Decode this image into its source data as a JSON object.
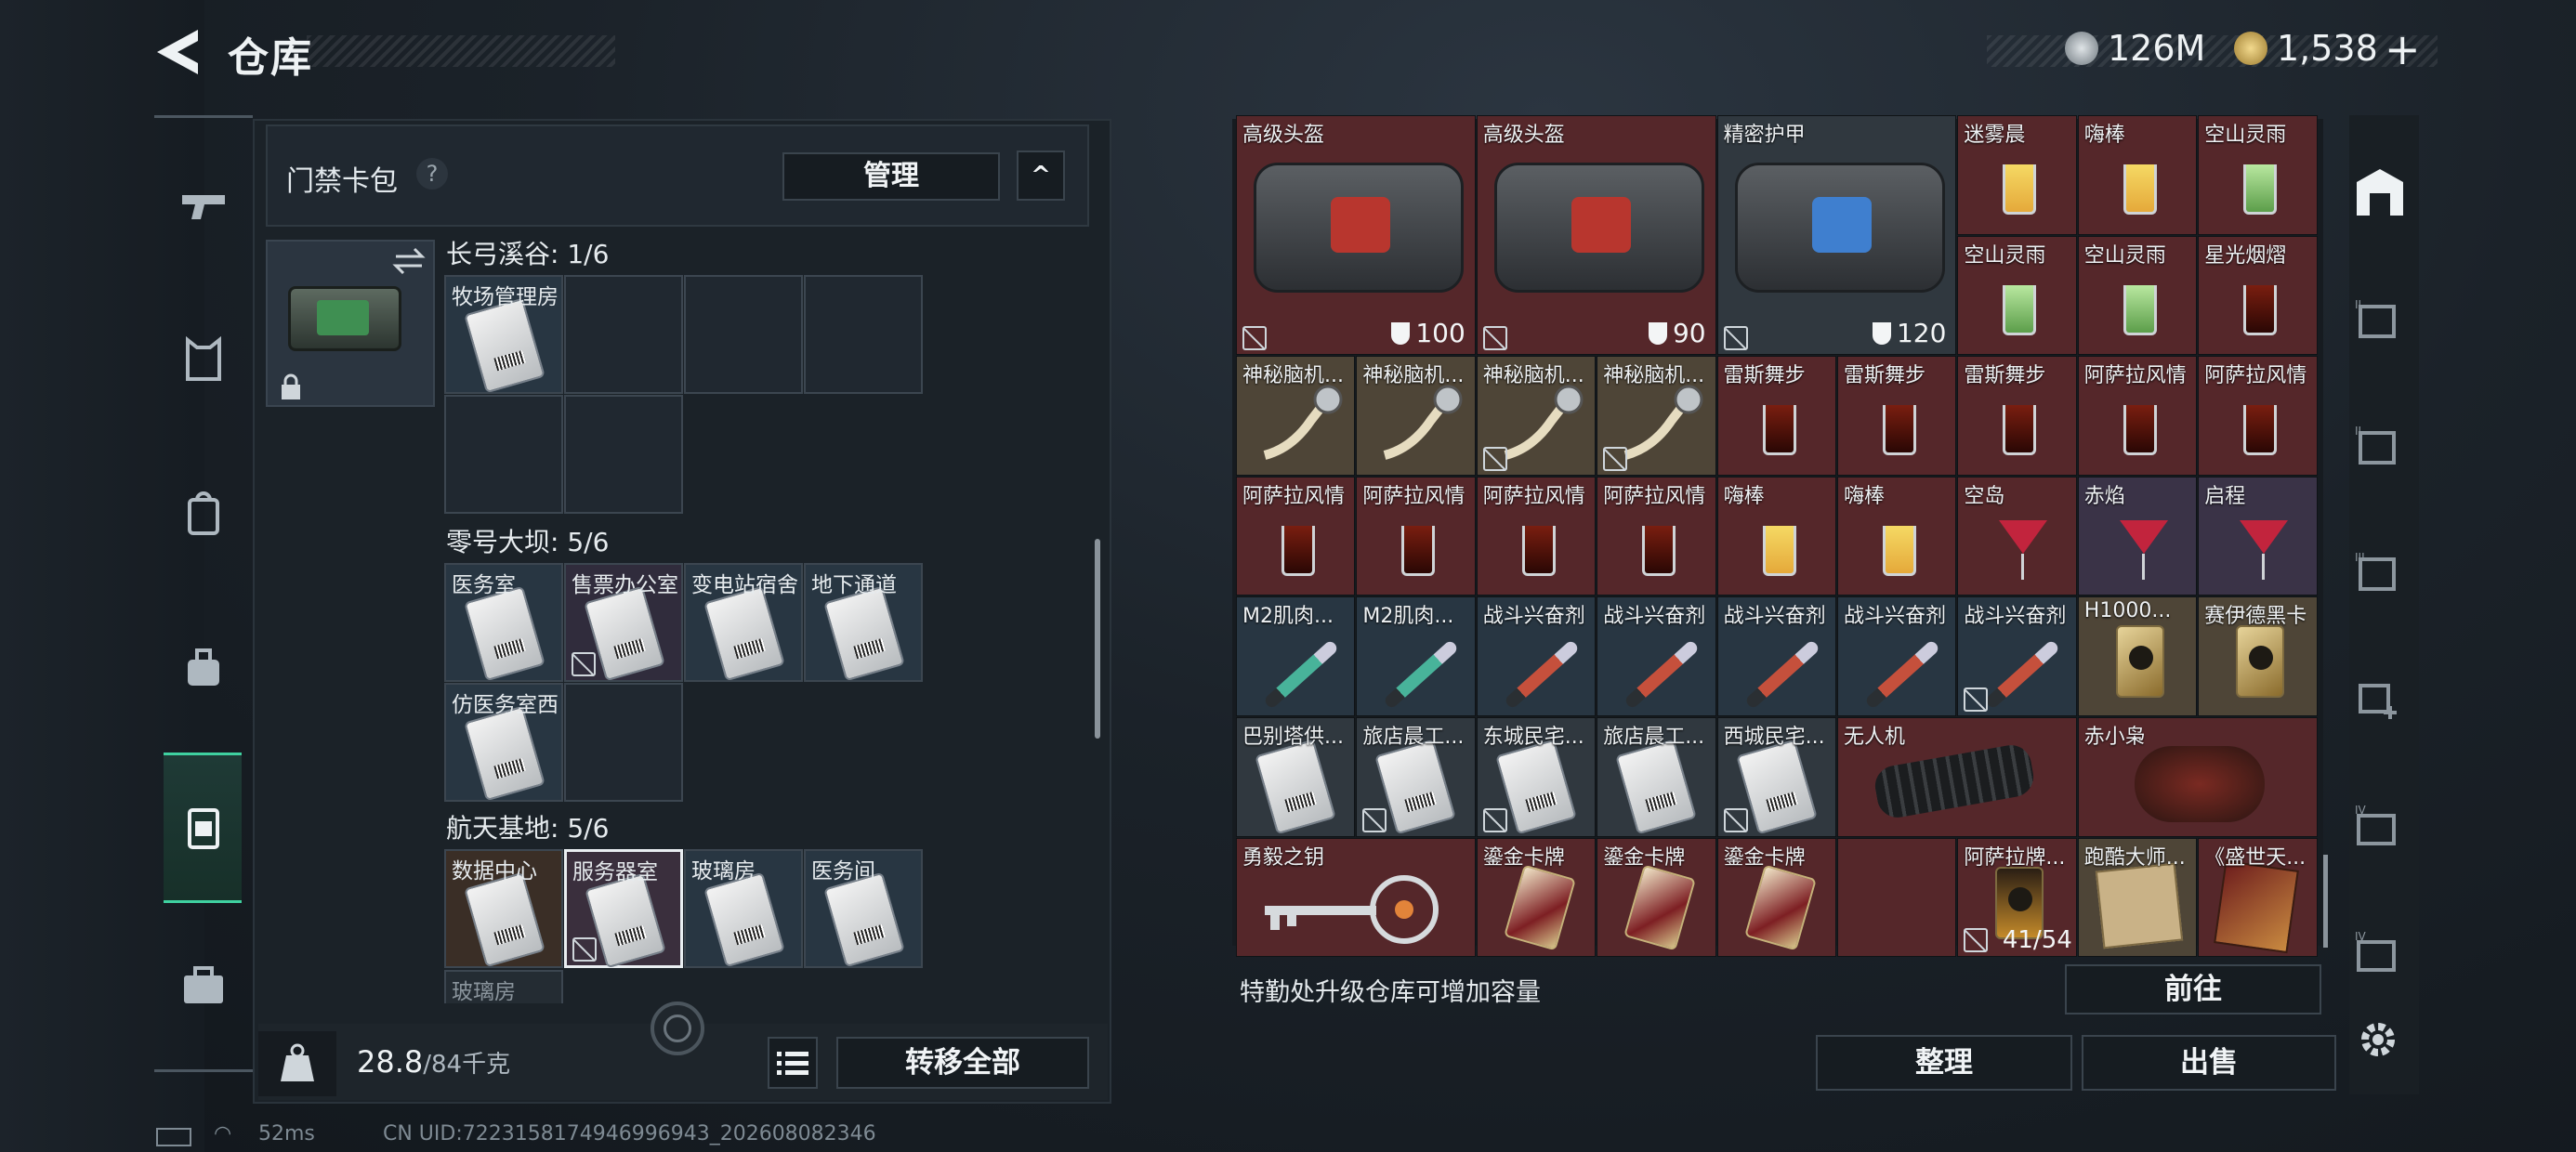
{
  "header": {
    "title": "仓库",
    "currency1": "126M",
    "currency2": "1,538",
    "plus": "+"
  },
  "left": {
    "header": "门禁卡包",
    "help": "?",
    "manage": "管理",
    "collapse": "^",
    "groups": [
      {
        "title": "长弓溪谷: 1/6",
        "cells": [
          "牧场管理房"
        ]
      },
      {
        "title": "零号大坝: 5/6",
        "cells": [
          "医务室",
          "售票办公室",
          "变电站宿舍",
          "地下通道",
          "仿医务室西"
        ]
      },
      {
        "title": "航天基地: 5/6",
        "cells": [
          "数据中心",
          "服务器室",
          "玻璃房",
          "医务间"
        ]
      }
    ],
    "partial": "玻璃房",
    "weight_value": "28.8",
    "weight_total": "/84千克",
    "transfer_all": "转移全部"
  },
  "right": {
    "items": [
      [
        "高级头盔",
        "高级头盔",
        "精密护甲",
        "迷雾晨",
        "嗨棒",
        "空山灵雨"
      ],
      [
        "",
        "",
        "",
        "空山灵雨",
        "空山灵雨",
        "星光烟熠"
      ],
      [
        "神秘脑机...",
        "神秘脑机...",
        "神秘脑机...",
        "神秘脑机...",
        "雷斯舞步",
        "雷斯舞步",
        "雷斯舞步",
        "阿萨拉风情",
        "阿萨拉风情"
      ],
      [
        "阿萨拉风情",
        "阿萨拉风情",
        "阿萨拉风情",
        "阿萨拉风情",
        "嗨棒",
        "嗨棒",
        "空岛",
        "赤焰",
        "启程"
      ],
      [
        "M2肌肉...",
        "M2肌肉...",
        "战斗兴奋剂",
        "战斗兴奋剂",
        "战斗兴奋剂",
        "战斗兴奋剂",
        "战斗兴奋剂",
        "H1000...",
        "赛伊德黑卡"
      ],
      [
        "巴别塔供...",
        "旅店晨工...",
        "东城民宅...",
        "旅店晨工...",
        "西城民宅...",
        "无人机",
        "赤小枭"
      ],
      [
        "勇毅之钥",
        "鎏金卡牌",
        "鎏金卡牌",
        "鎏金卡牌",
        "阿萨拉牌...",
        "跑酷大师...",
        "《盛世天..."
      ]
    ],
    "durability": [
      "100",
      "90",
      "120"
    ],
    "stack": "41/54",
    "upgrade_hint": "特勤处升级仓库可增加容量",
    "goto": "前往",
    "sort": "整理",
    "sell": "出售"
  },
  "status": {
    "ping": "52ms",
    "uid": "CN UID:7223158174946996943_202608082346"
  }
}
